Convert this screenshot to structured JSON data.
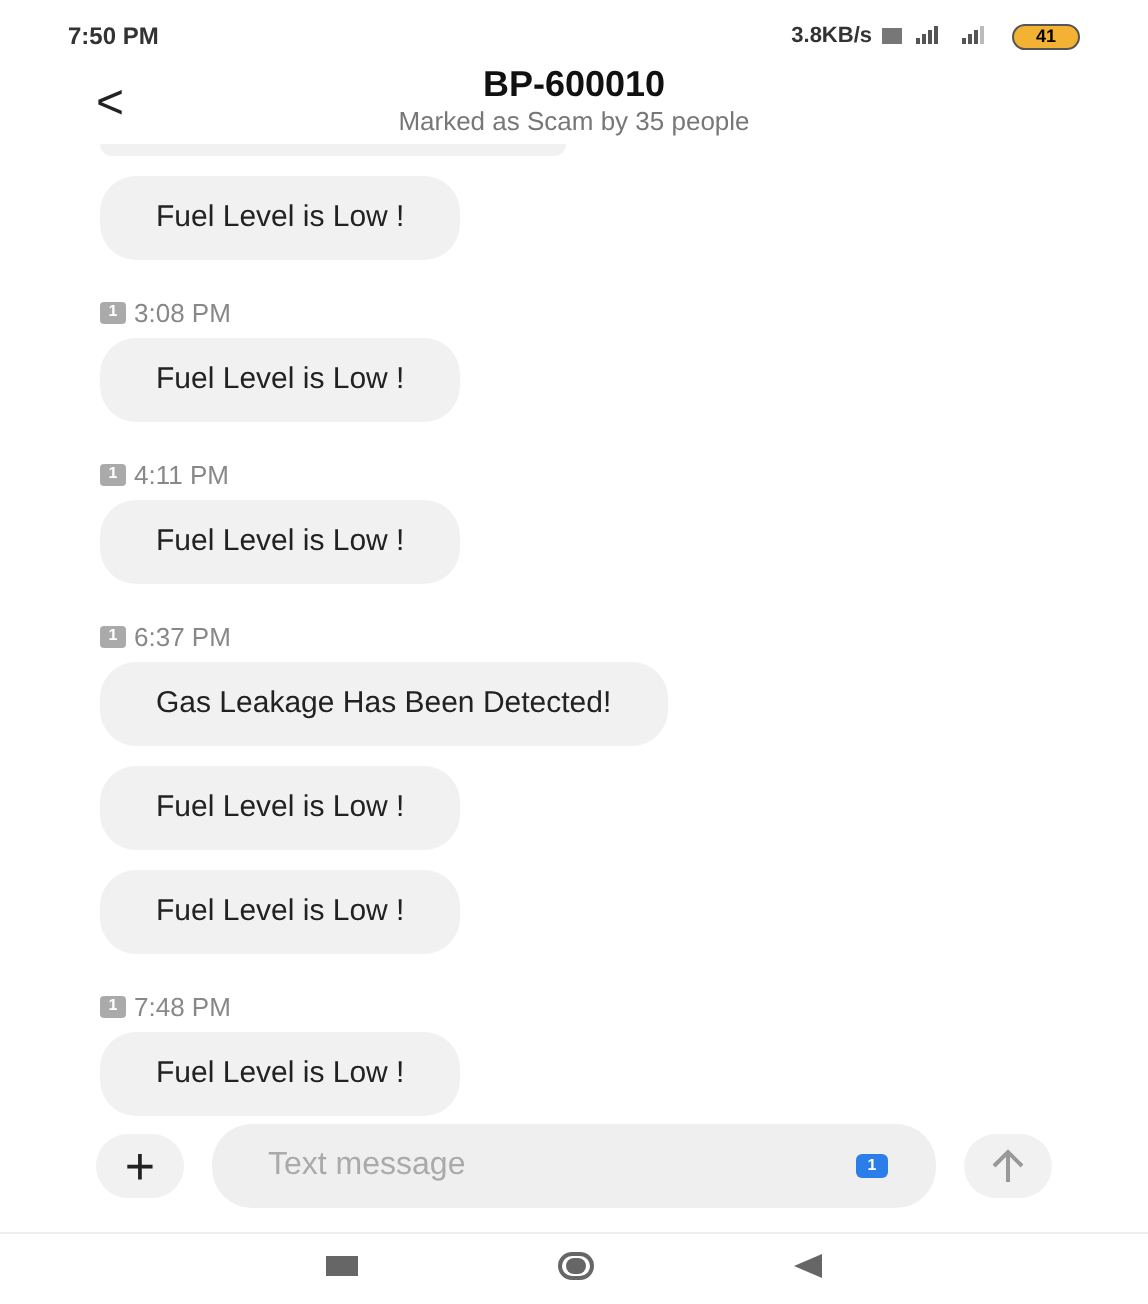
{
  "status_bar": {
    "time": "7:50 PM",
    "speed": "3.8KB/s",
    "battery": "41"
  },
  "header": {
    "back": "<",
    "title": "BP-600010",
    "subtitle": "Marked as Scam by 35 people"
  },
  "messages": [
    {
      "kind": "bubble",
      "text": "Fuel Level is Low !"
    },
    {
      "kind": "time",
      "sim": "1",
      "text": "3:08 PM"
    },
    {
      "kind": "bubble",
      "text": "Fuel Level is Low !"
    },
    {
      "kind": "time",
      "sim": "1",
      "text": "4:11 PM"
    },
    {
      "kind": "bubble",
      "text": "Fuel Level is Low !"
    },
    {
      "kind": "time",
      "sim": "1",
      "text": "6:37 PM"
    },
    {
      "kind": "bubble",
      "text": "Gas Leakage Has Been Detected!"
    },
    {
      "kind": "bubble",
      "text": "Fuel Level is Low !"
    },
    {
      "kind": "bubble",
      "text": "Fuel Level is Low !"
    },
    {
      "kind": "time",
      "sim": "1",
      "text": "7:48 PM"
    },
    {
      "kind": "bubble",
      "text": "Fuel Level is Low !"
    }
  ],
  "composer": {
    "add": "+",
    "placeholder": "Text message",
    "sim": "1"
  }
}
